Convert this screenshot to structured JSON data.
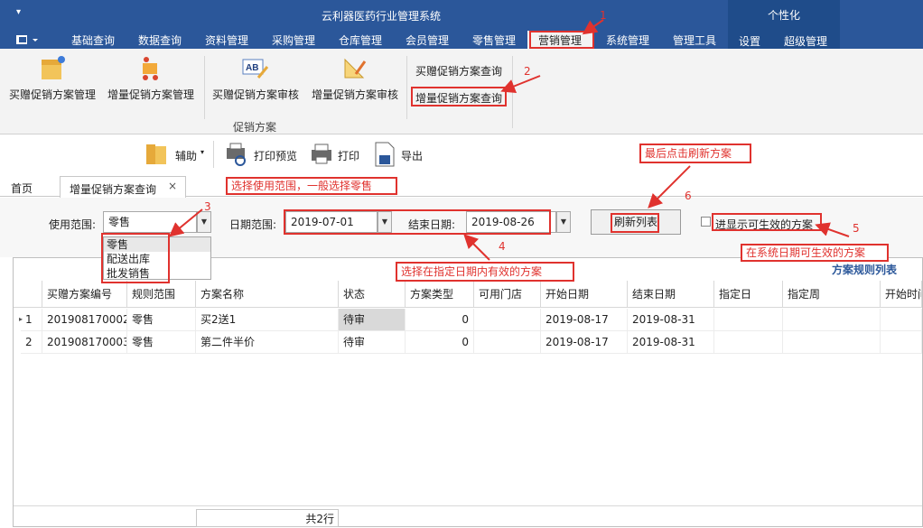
{
  "app": {
    "title": "云利器医药行业管理系统",
    "personalize": "个性化",
    "quick_access": "▾"
  },
  "menu": {
    "file_icon": "menu-grid-icon",
    "tabs": [
      "基础查询",
      "数据查询",
      "资料管理",
      "采购管理",
      "仓库管理",
      "会员管理",
      "零售管理",
      "营销管理",
      "系统管理",
      "管理工具",
      "设置",
      "超级管理"
    ]
  },
  "ribbon": {
    "buttons": [
      "买赠促销方案管理",
      "增量促销方案管理",
      "买赠促销方案审核",
      "增量促销方案审核"
    ],
    "small": [
      "买赠促销方案查询",
      "增量促销方案查询"
    ],
    "group": "促销方案"
  },
  "toolbar": {
    "assist": "辅助",
    "preview": "打印预览",
    "print": "打印",
    "export": "导出"
  },
  "tabs": [
    "首页",
    "增量促销方案查询"
  ],
  "filter": {
    "scope_label": "使用范围:",
    "scope_value": "零售",
    "scope_options": [
      "零售",
      "配送出库",
      "批发销售"
    ],
    "date_label": "日期范围:",
    "start_date": "2019-07-01",
    "end_label": "结束日期:",
    "end_date": "2019-08-26",
    "refresh": "刷新列表",
    "only_valid": "进显示可生效的方案"
  },
  "annotations": {
    "n1": "1",
    "n2": "2",
    "n3": "3",
    "n4": "4",
    "n5": "5",
    "n6": "6",
    "a3": "选择使用范围，一般选择零售",
    "a4": "选择在指定日期内有效的方案",
    "a5": "在系统日期可生效的方案",
    "a6": "最后点击刷新方案"
  },
  "grid": {
    "title": "方案规则列表",
    "columns": [
      "买赠方案编号",
      "规则范围",
      "方案名称",
      "状态",
      "方案类型",
      "可用门店",
      "开始日期",
      "结束日期",
      "指定日",
      "指定周",
      "开始时间"
    ],
    "rows": [
      {
        "idx": "1",
        "cells": [
          "201908170002",
          "零售",
          "买2送1",
          "待审",
          "0",
          "",
          "2019-08-17",
          "2019-08-31",
          "",
          "",
          ""
        ]
      },
      {
        "idx": "2",
        "cells": [
          "201908170003",
          "零售",
          "第二件半价",
          "待审",
          "0",
          "",
          "2019-08-17",
          "2019-08-31",
          "",
          "",
          ""
        ]
      }
    ],
    "footer": "共2行",
    "row_pointer": "▸"
  },
  "colors": {
    "accent": "#2b579a",
    "annotation": "#e0322e"
  }
}
